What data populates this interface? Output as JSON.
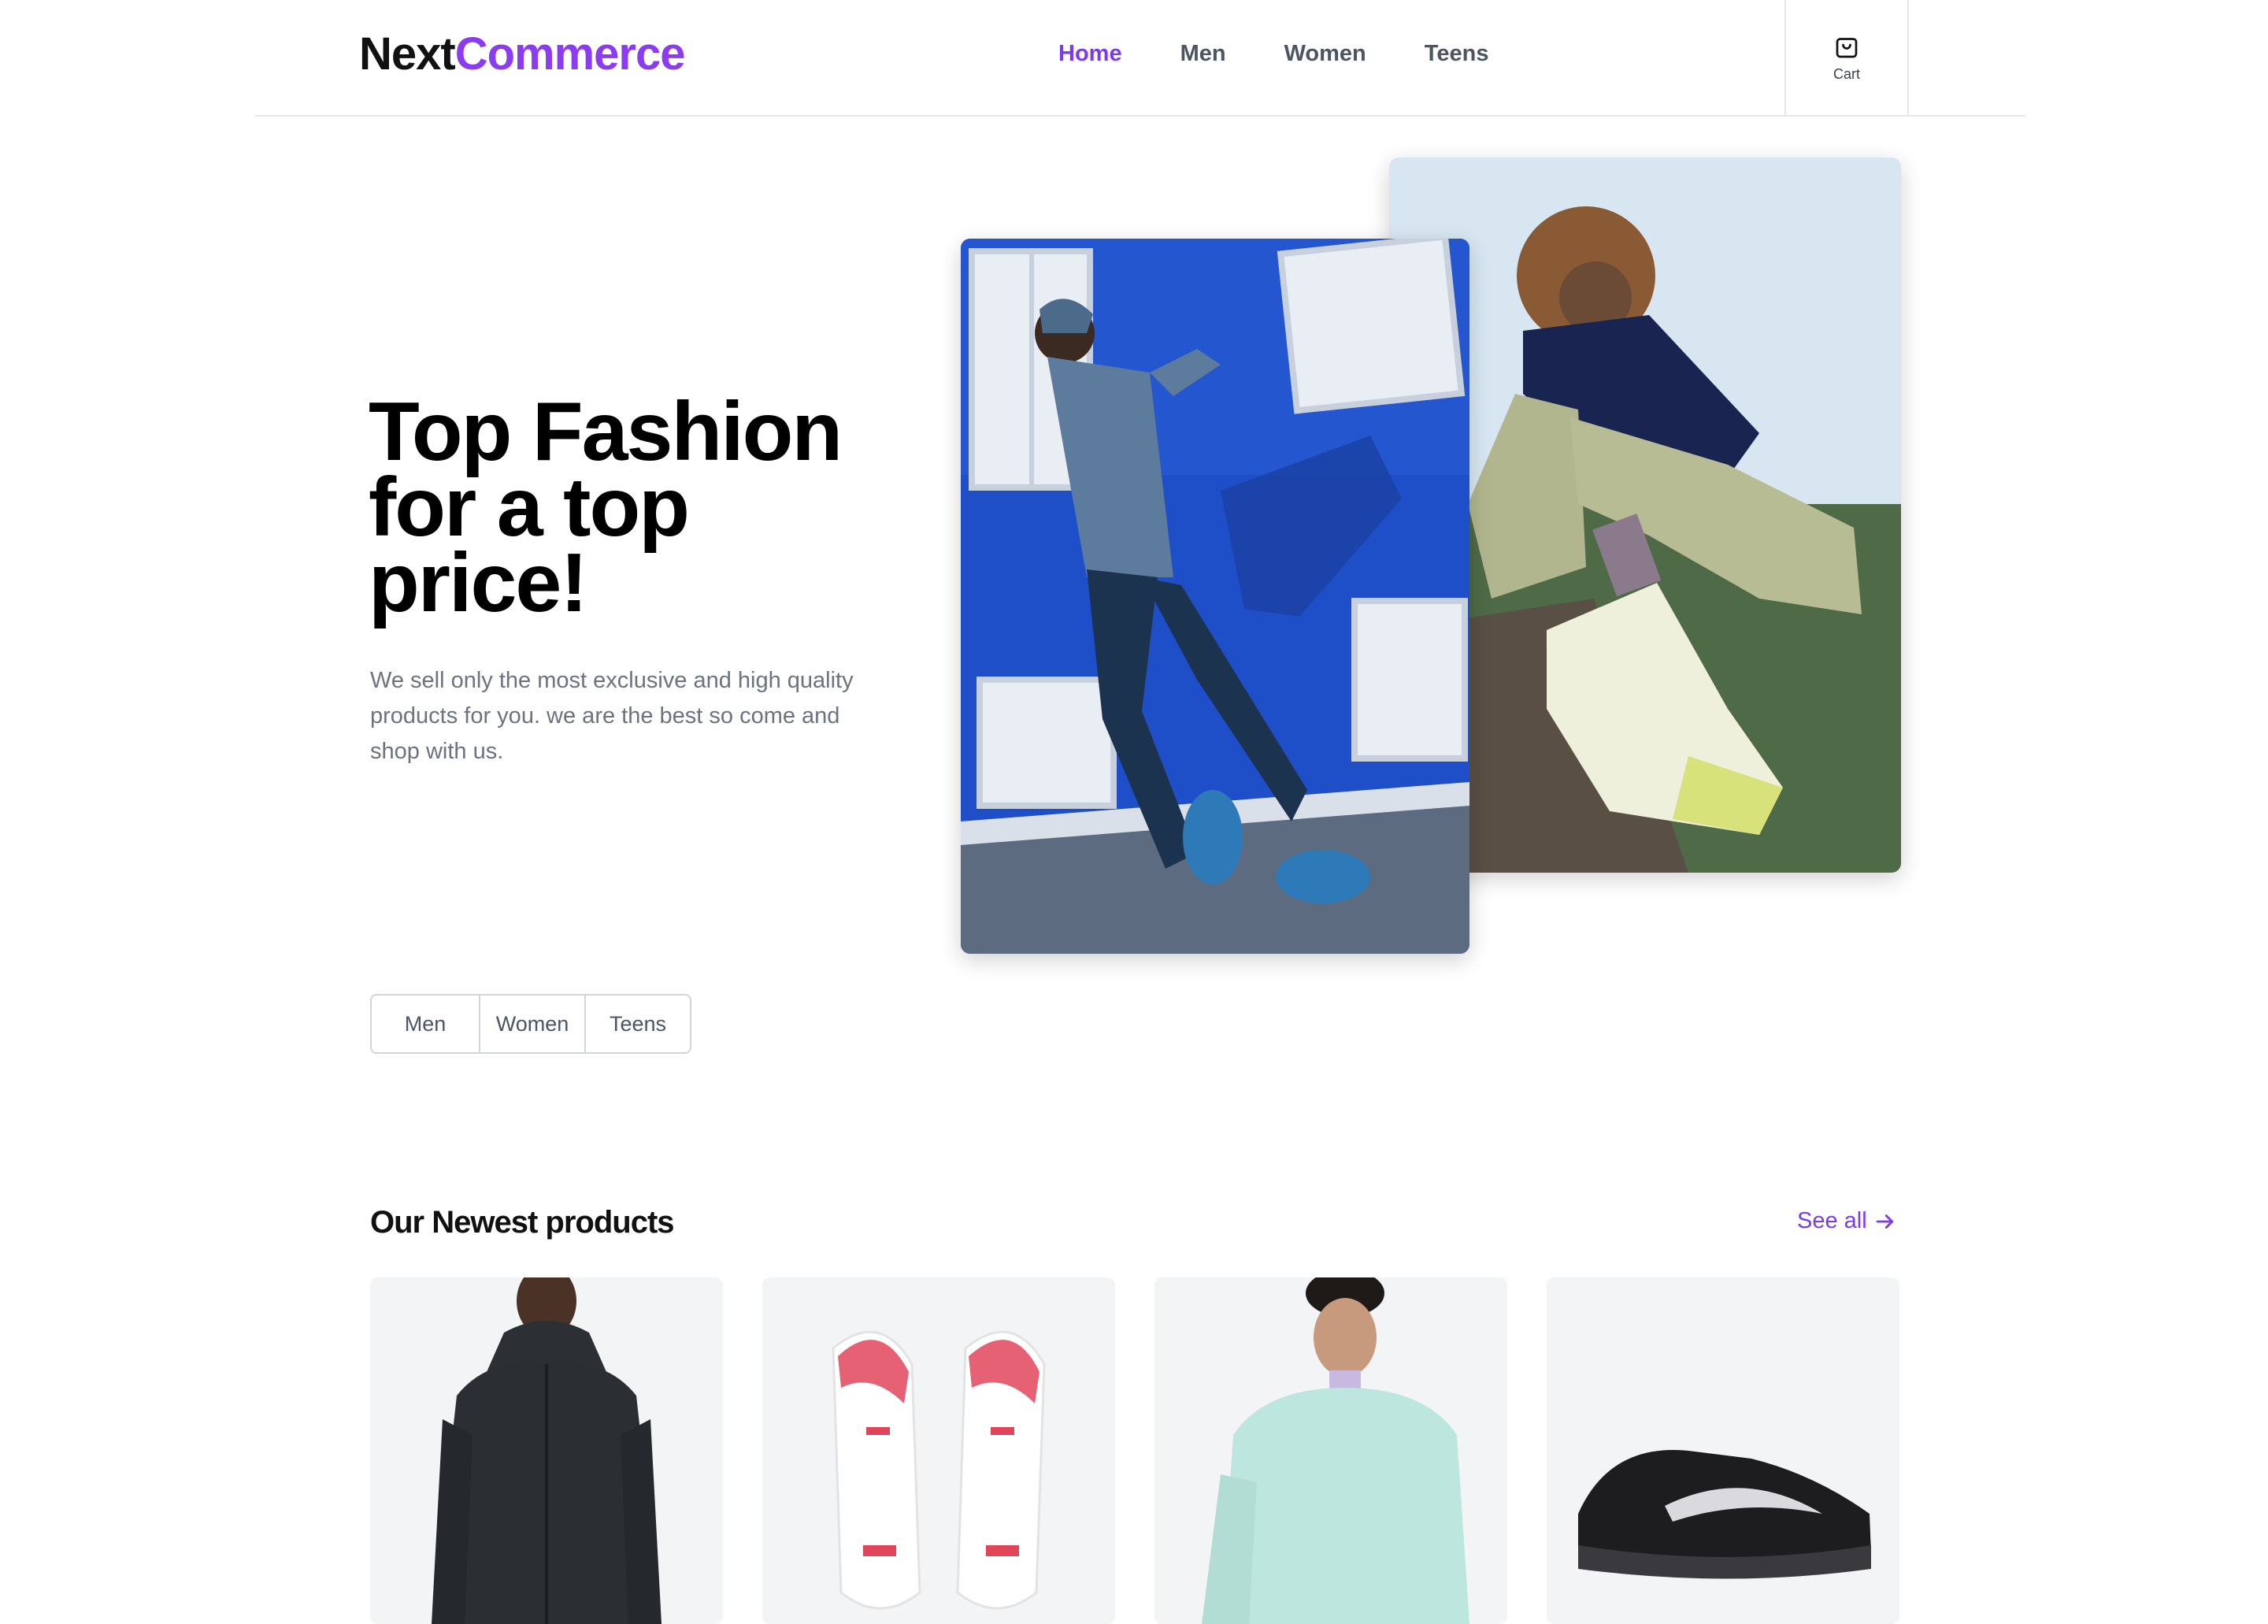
{
  "header": {
    "logo_part1": "Next",
    "logo_part2": "Commerce",
    "nav": [
      "Home",
      "Men",
      "Women",
      "Teens"
    ],
    "active_nav": "Home",
    "cart_label": "Cart",
    "cart_icon": "shopping-bag-icon"
  },
  "hero": {
    "title": "Top Fashion for a top price!",
    "description": "We sell only the most exclusive and high quality products for you. we are the best so come and shop with us.",
    "images": [
      "runner-image",
      "sitting-woman-sneaker-image"
    ]
  },
  "categories": [
    "Men",
    "Women",
    "Teens"
  ],
  "products_section": {
    "title": "Our Newest products",
    "see_all": "See all",
    "see_all_icon": "arrow-right-icon",
    "products": [
      "black-jacket-image",
      "white-red-sneakers-image",
      "mint-sweatshirt-image",
      "black-running-shoe-image"
    ]
  },
  "colors": {
    "accent": "#7c3aed",
    "logo_accent": "#8b3cf0",
    "border": "#e5e7eb",
    "card_bg": "#f3f4f6",
    "hero_blue": "#1e4fc8"
  }
}
